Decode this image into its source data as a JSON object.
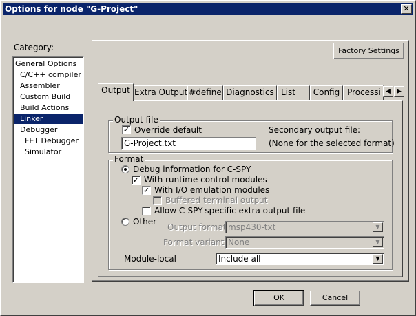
{
  "window": {
    "title": "Options for node \"G-Project\"",
    "close_glyph": "✕"
  },
  "category": {
    "label": "Category:",
    "items": [
      {
        "label": "General Options",
        "indent": 0
      },
      {
        "label": "C/C++ compiler",
        "indent": 1
      },
      {
        "label": "Assembler",
        "indent": 1
      },
      {
        "label": "Custom Build",
        "indent": 1
      },
      {
        "label": "Build Actions",
        "indent": 1
      },
      {
        "label": "Linker",
        "indent": 1,
        "selected": true
      },
      {
        "label": "Debugger",
        "indent": 1
      },
      {
        "label": "FET Debugger",
        "indent": 2
      },
      {
        "label": "Simulator",
        "indent": 2
      }
    ]
  },
  "factory_settings_label": "Factory Settings",
  "tabs": [
    "Output",
    "Extra Output",
    "#define",
    "Diagnostics",
    "List",
    "Config",
    "Processi"
  ],
  "active_tab": "Output",
  "output_file": {
    "group_title": "Output file",
    "override_label": "Override default",
    "override_checked": true,
    "filename": "G-Project.txt",
    "secondary_label": "Secondary output file:",
    "secondary_value": "(None for the selected format)"
  },
  "format": {
    "group_title": "Format",
    "debug_info_label": "Debug information for C-SPY",
    "debug_info_selected": true,
    "runtime_modules_label": "With runtime control modules",
    "runtime_modules_checked": true,
    "io_emulation_label": "With I/O emulation modules",
    "io_emulation_checked": true,
    "buffered_output_label": "Buffered terminal output",
    "buffered_output_checked": false,
    "allow_extra_output_label": "Allow C-SPY-specific extra output file",
    "allow_extra_output_checked": false,
    "other_label": "Other",
    "other_selected": false,
    "output_format_label": "Output format:",
    "output_format_value": "msp430-txt",
    "format_variant_label": "Format variant:",
    "format_variant_value": "None"
  },
  "module_local": {
    "label": "Module-local",
    "value": "Include all"
  },
  "buttons": {
    "ok": "OK",
    "cancel": "Cancel"
  }
}
